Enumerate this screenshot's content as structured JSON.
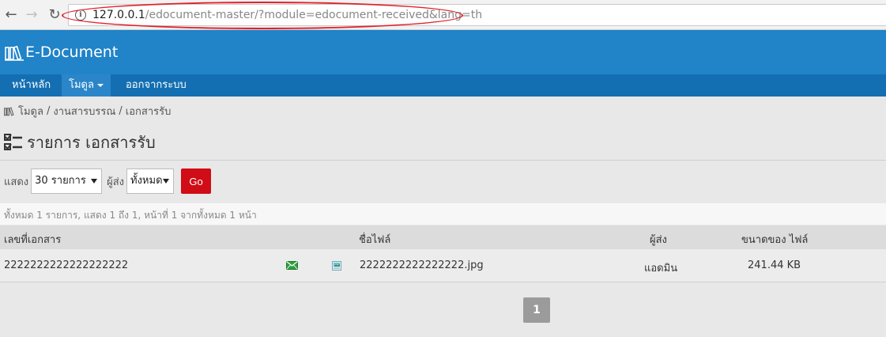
{
  "browser": {
    "url_host": "127.0.0.1",
    "url_path": "/edocument-master/?module=edocument-received&lang=th",
    "back_glyph": "←",
    "forward_glyph": "→",
    "reload_glyph": "↻",
    "info_glyph": "i"
  },
  "app": {
    "title": "E-Document",
    "brand_color": "#2183c8"
  },
  "menu": {
    "home": "หน้าหลัก",
    "module": "โมดูล",
    "logout": "ออกจากระบบ"
  },
  "breadcrumb": {
    "module": "โมดูล",
    "sep1": "/",
    "section": "งานสารบรรณ",
    "sep2": "/",
    "page": "เอกสารรับ"
  },
  "page": {
    "title": "รายการ เอกสารรับ"
  },
  "filters": {
    "show_label": "แสดง",
    "show_value": "30 รายการ",
    "sender_label": "ผู้ส่ง",
    "sender_value": "ทั้งหมด",
    "go_label": "Go"
  },
  "summary": {
    "text": "ทั้งหมด 1 รายการ, แสดง 1 ถึง 1, หน้าที่ 1 จากทั้งหมด 1 หน้า"
  },
  "table": {
    "headers": {
      "doc_no": "เลขที่เอกสาร",
      "file_name": "ชื่อไฟล์",
      "sender": "ผู้ส่ง",
      "file_size": "ขนาดของ ไฟล์"
    },
    "rows": [
      {
        "doc_no": "2222222222222222222",
        "file_name": "2222222222222222.jpg",
        "sender": "แอดมิน",
        "file_size": "241.44 KB"
      }
    ]
  },
  "pagination": {
    "current": "1"
  }
}
